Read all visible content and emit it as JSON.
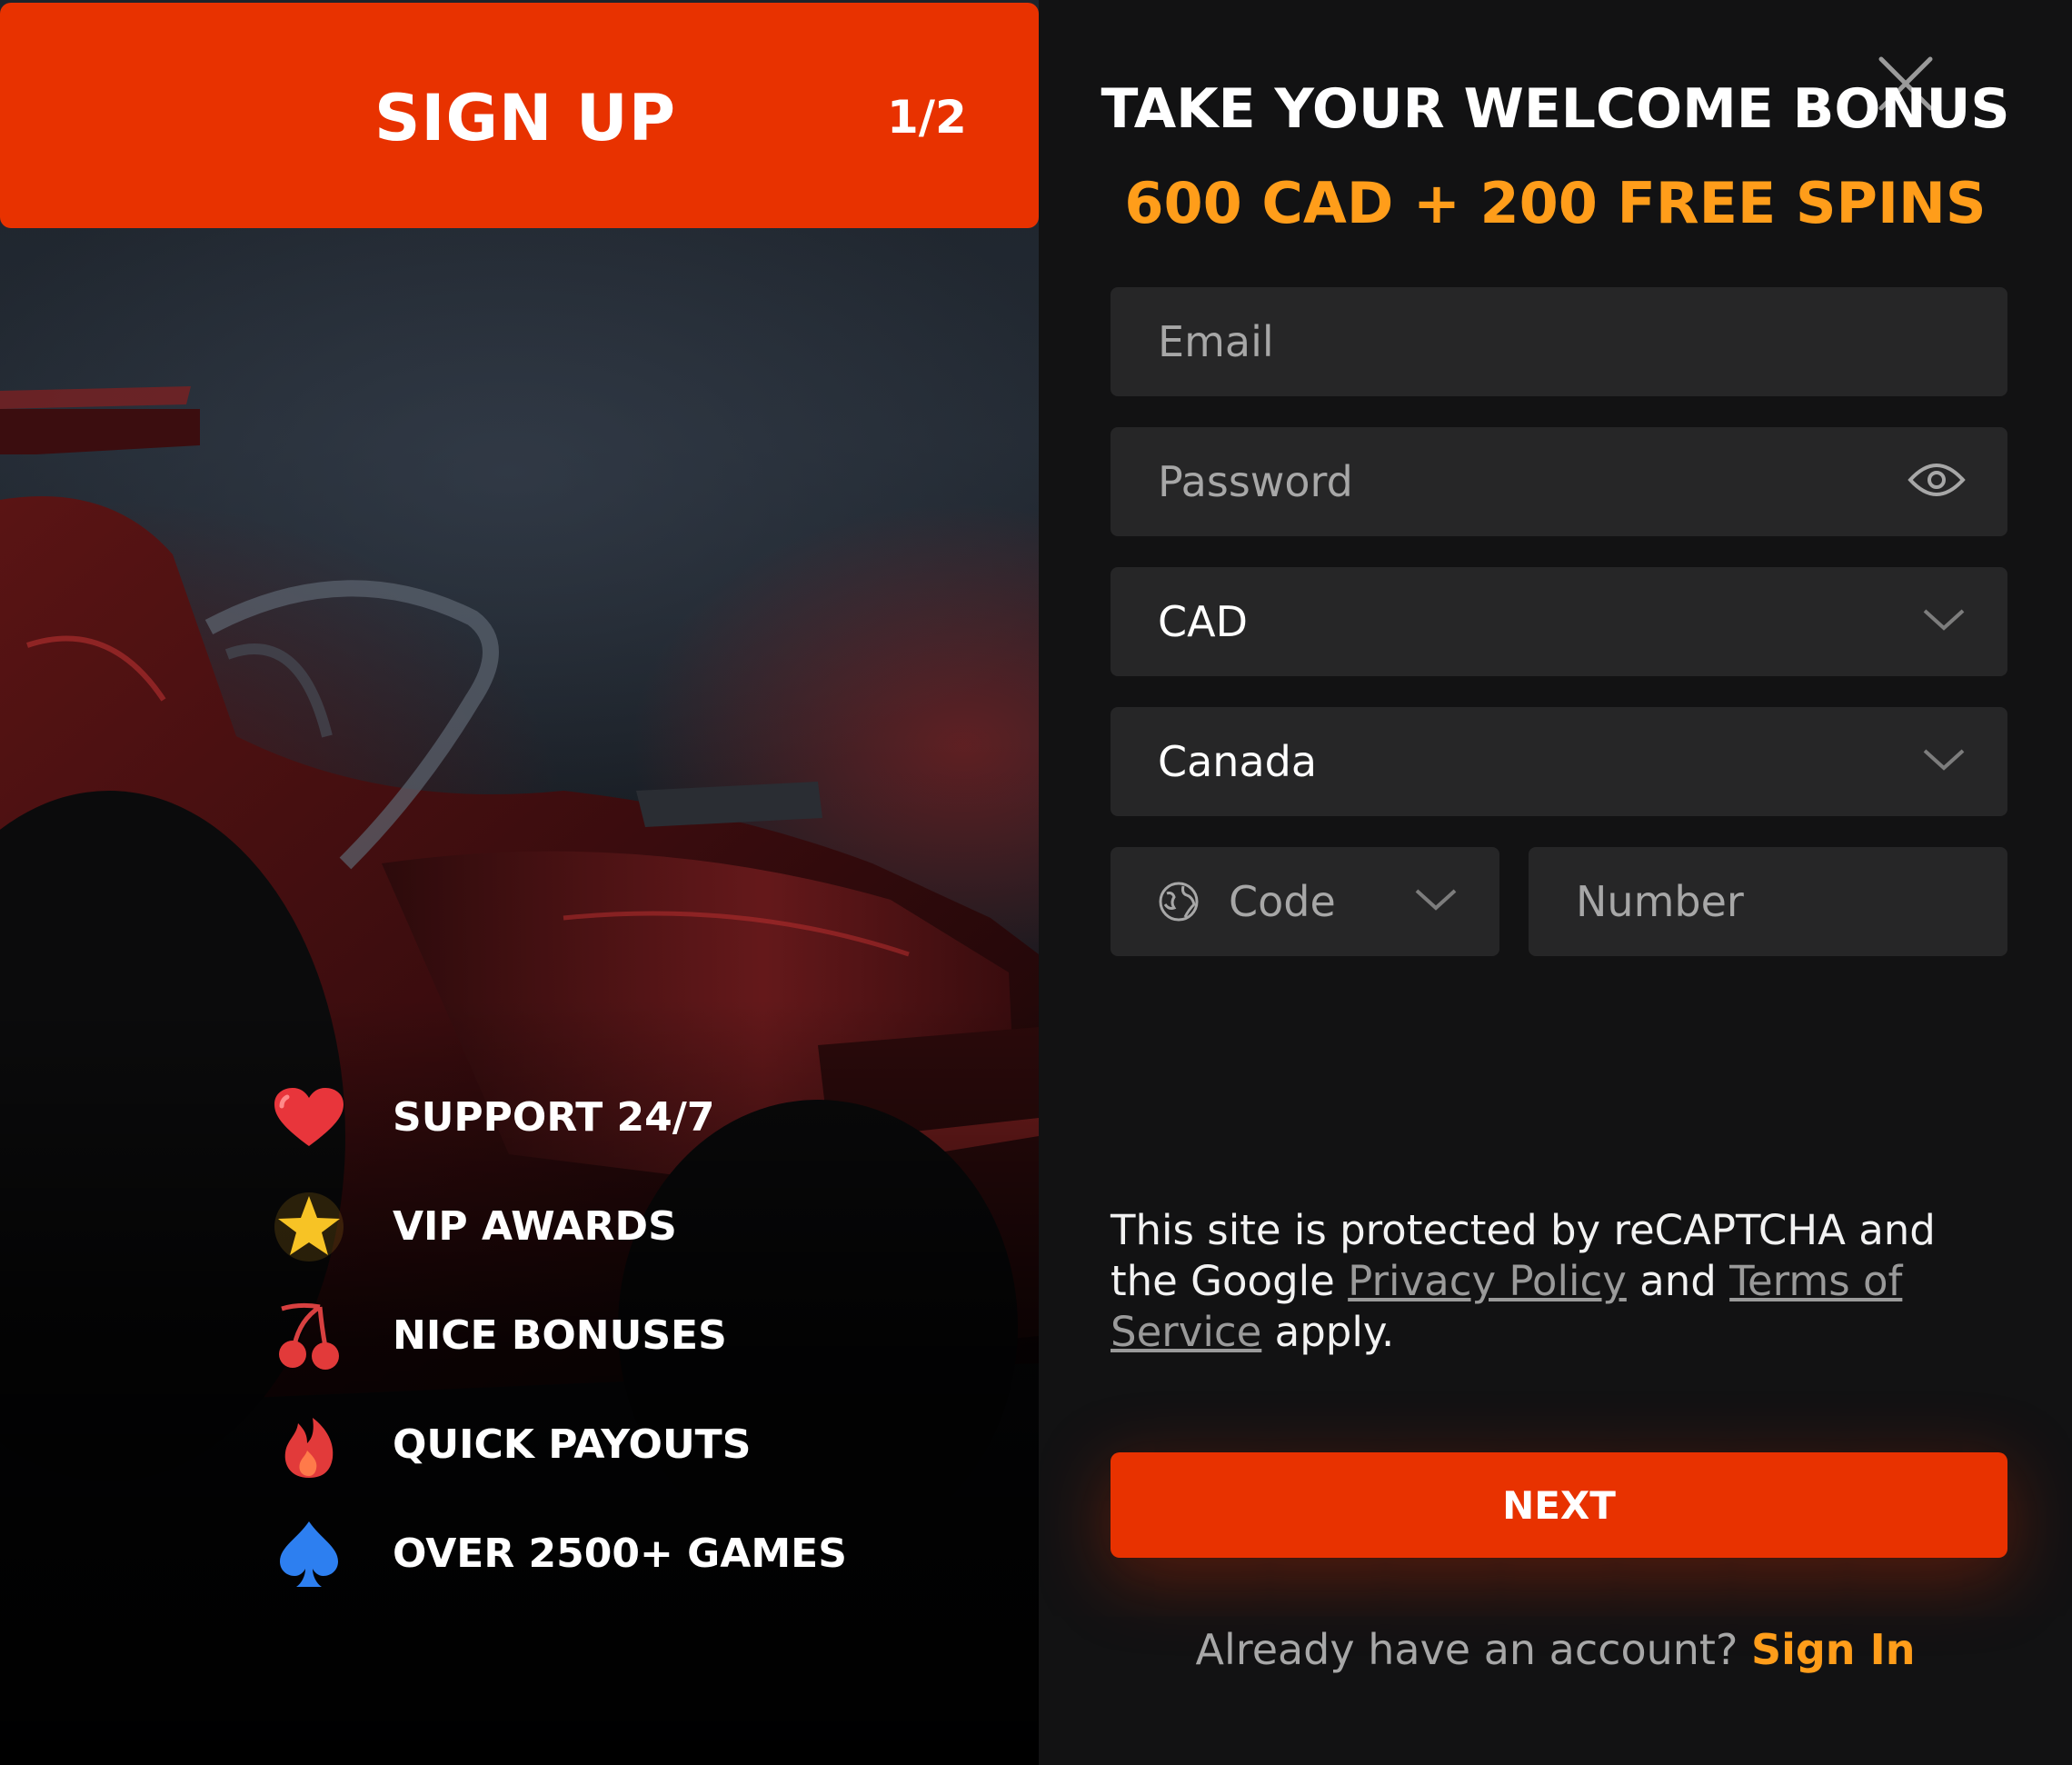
{
  "signup": {
    "title": "SIGN UP",
    "step": "1/2"
  },
  "features": [
    {
      "label": "SUPPORT 24/7",
      "icon": "heart-icon"
    },
    {
      "label": "VIP AWARDS",
      "icon": "star-icon"
    },
    {
      "label": "NICE BONUSES",
      "icon": "cherry-icon"
    },
    {
      "label": "QUICK PAYOUTS",
      "icon": "flame-icon"
    },
    {
      "label": "OVER 2500+ GAMES",
      "icon": "spade-icon"
    }
  ],
  "header": {
    "welcome": "TAKE YOUR WELCOME BONUS",
    "bonus": "600 CAD + 200 FREE SPINS"
  },
  "form": {
    "email_placeholder": "Email",
    "password_placeholder": "Password",
    "currency_value": "CAD",
    "country_value": "Canada",
    "code_placeholder": "Code",
    "number_placeholder": "Number"
  },
  "recaptcha": {
    "text_1": "This site is protected by reCAPTCHA and the Google ",
    "privacy_link": "Privacy Policy",
    "text_2": " and ",
    "terms_link": "Terms of Service",
    "text_3": " apply."
  },
  "next_label": "NEXT",
  "footer": {
    "question": "Already have an account? ",
    "signin_label": "Sign In"
  },
  "colors": {
    "accent": "#e83200",
    "bonus": "#ff9d1a",
    "field_bg": "#262627",
    "panel_bg": "#121213"
  }
}
